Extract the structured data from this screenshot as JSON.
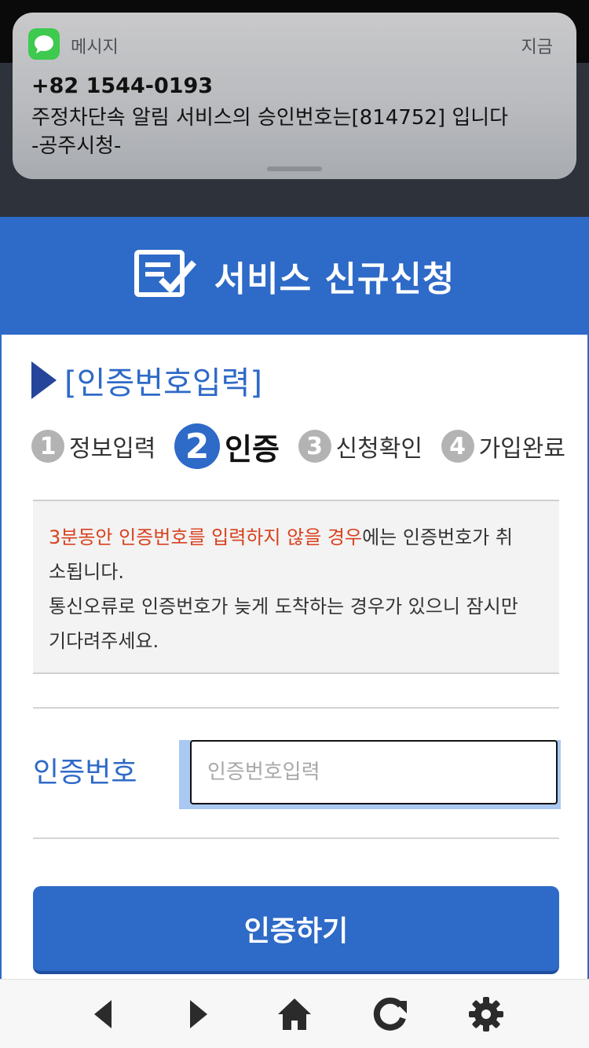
{
  "notification": {
    "app_name": "메시지",
    "time": "지금",
    "sender": "+82 1544-0193",
    "message_line1": "주정차단속 알림 서비스의 승인번호는[814752] 입니다",
    "message_line2": "-공주시청-",
    "app_icon": "messages-icon"
  },
  "header": {
    "title": "서비스 신규신청",
    "icon": "checklist-icon"
  },
  "section": {
    "title": "[인증번호입력]"
  },
  "steps": [
    {
      "num": "1",
      "label": "정보입력",
      "active": false
    },
    {
      "num": "2",
      "label": "인증",
      "active": true
    },
    {
      "num": "3",
      "label": "신청확인",
      "active": false
    },
    {
      "num": "4",
      "label": "가입완료",
      "active": false
    }
  ],
  "notice": {
    "highlight": "3분동안 인증번호를 입력하지 않을 경우",
    "line1_rest": "에는 인증번호가 취",
    "line1_cont": "소됩니다.",
    "line2": "통신오류로 인증번호가 늦게 도착하는 경우가 있으니 잠시만",
    "line2_cont": "기다려주세요."
  },
  "form": {
    "label": "인증번호",
    "placeholder": "인증번호입력",
    "value": ""
  },
  "submit": {
    "label": "인증하기"
  },
  "toolbar": {
    "items": [
      "back-icon",
      "forward-icon",
      "home-icon",
      "refresh-icon",
      "settings-icon"
    ]
  },
  "colors": {
    "brand": "#2e6ac7",
    "accent_dark": "#25459a",
    "warning": "#d9411e"
  }
}
